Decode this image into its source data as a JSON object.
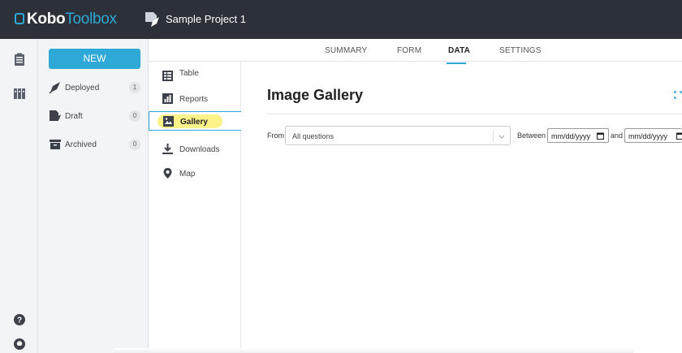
{
  "app": {
    "logo_bold": "Kobo",
    "logo_light": "Toolbox",
    "project_title": "Sample Project 1"
  },
  "drawer": {
    "new_label": "NEW",
    "items": [
      {
        "label": "Deployed",
        "count": "1",
        "icon": "rocket-icon"
      },
      {
        "label": "Draft",
        "count": "0",
        "icon": "draft-icon"
      },
      {
        "label": "Archived",
        "count": "0",
        "icon": "archive-icon"
      }
    ]
  },
  "rail": {
    "icons": [
      "forms-icon",
      "library-icon",
      "help-icon",
      "github-icon"
    ]
  },
  "tabs": [
    {
      "label": "SUMMARY"
    },
    {
      "label": "FORM"
    },
    {
      "label": "DATA",
      "active": true
    },
    {
      "label": "SETTINGS"
    }
  ],
  "subnav": [
    {
      "label": "Table",
      "icon": "table-icon"
    },
    {
      "label": "Reports",
      "icon": "reports-icon"
    },
    {
      "label": "Gallery",
      "icon": "gallery-icon",
      "active": true
    },
    {
      "label": "Downloads",
      "icon": "download-icon"
    },
    {
      "label": "Map",
      "icon": "map-pin-icon"
    }
  ],
  "main": {
    "title": "Image Gallery",
    "filter": {
      "from_label": "From",
      "select_value": "All questions",
      "between_label": "Between",
      "date_from": "mm/dd/yyyy",
      "and_label": "and",
      "date_to": "mm/dd/yyyy"
    }
  },
  "colors": {
    "topbar": "#2c3039",
    "accent": "#2ea8d6",
    "highlight": "#fbf28a"
  }
}
